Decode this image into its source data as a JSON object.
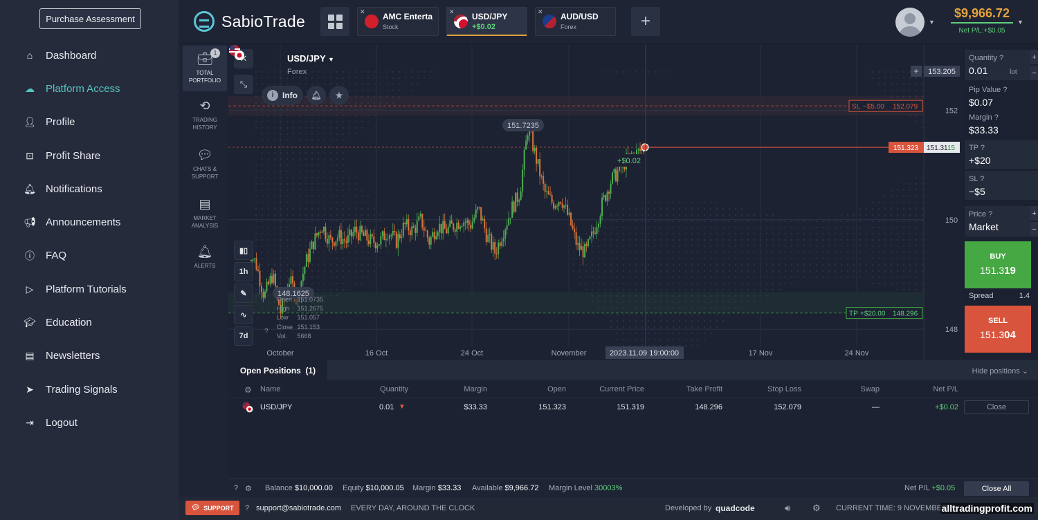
{
  "site_sidebar": {
    "purchase_label": "Purchase Assessment",
    "items": [
      {
        "label": "Dashboard",
        "icon": "home-icon"
      },
      {
        "label": "Platform Access",
        "icon": "cloud-download-icon",
        "active": true
      },
      {
        "label": "Profile",
        "icon": "user-icon"
      },
      {
        "label": "Profit Share",
        "icon": "profit-share-icon"
      },
      {
        "label": "Notifications",
        "icon": "bell-icon"
      },
      {
        "label": "Announcements",
        "icon": "megaphone-icon"
      },
      {
        "label": "FAQ",
        "icon": "question-icon"
      },
      {
        "label": "Platform Tutorials",
        "icon": "play-icon"
      },
      {
        "label": "Education",
        "icon": "graduation-cap-icon"
      },
      {
        "label": "Newsletters",
        "icon": "newspaper-icon"
      },
      {
        "label": "Trading Signals",
        "icon": "telegram-icon"
      },
      {
        "label": "Logout",
        "icon": "logout-icon"
      }
    ]
  },
  "header": {
    "logo_text": "SabioTrade",
    "tabs": [
      {
        "name": "AMC Enterta...",
        "sub": "Stock"
      },
      {
        "name": "USD/JPY",
        "sub": "+$0.02"
      },
      {
        "name": "AUD/USD",
        "sub": "Forex"
      }
    ],
    "balance": "$9,966.72",
    "net_pl": "Net P/L:+$0.05"
  },
  "tools": [
    {
      "label1": "TOTAL",
      "label2": "PORTFOLIO",
      "badge": "1"
    },
    {
      "label1": "TRADING",
      "label2": "HISTORY"
    },
    {
      "label1": "CHATS &",
      "label2": "SUPPORT"
    },
    {
      "label1": "MARKET",
      "label2": "ANALYSIS"
    },
    {
      "label1": "ALERTS",
      "label2": ""
    }
  ],
  "chart": {
    "asset": "USD/JPY",
    "asset_type": "Forex",
    "info_label": "Info",
    "timeframes": [
      "1h",
      "7d"
    ],
    "ohlc": {
      "open": "151.0735",
      "high": "151.2675",
      "low": "151.057",
      "close": "151.153",
      "vol": "5668"
    },
    "ohlc_labels": {
      "open": "Open",
      "high": "High",
      "low": "Low",
      "close": "Close",
      "vol": "Vol."
    },
    "sl_label": "SL",
    "sl_amount": "−$5.00",
    "sl_price": "152.079",
    "tp_label": "TP",
    "tp_amount": "+$20.00",
    "tp_price": "148.296",
    "open_price": "151.323",
    "current_price_main": "151.31",
    "current_price_tail": "15",
    "top_price": "153.205",
    "high_label": "151.7235",
    "low_label": "148.1625",
    "pl_label": "+$0.02",
    "crosshair_time": "2023.11.09 19:00:00"
  },
  "chart_data": {
    "type": "candlestick",
    "y_ticks": [
      "152",
      "150",
      "148"
    ],
    "x_ticks": [
      "October",
      "16 Oct",
      "24 Oct",
      "November",
      "17 Nov",
      "24 Nov"
    ],
    "ylim": [
      147.9,
      152.7
    ],
    "series": [
      {
        "name": "USD/JPY",
        "values": [
          149.5,
          149.2,
          148.6,
          149.0,
          148.3,
          148.9,
          148.6,
          149.2,
          149.6,
          149.9,
          149.6,
          149.7,
          149.6,
          149.8,
          149.7,
          149.6,
          149.6,
          149.8,
          149.6,
          149.9,
          149.8,
          150.0,
          149.6,
          149.9,
          149.8,
          149.9,
          150.0,
          149.9,
          150.2,
          149.7,
          149.4,
          149.8,
          150.2,
          150.5,
          151.7,
          151.1,
          150.5,
          150.3,
          150.4,
          150.0,
          149.5,
          149.4,
          149.8,
          150.3,
          150.7,
          150.9,
          151.1,
          151.2,
          151.3
        ]
      }
    ]
  },
  "trade": {
    "quantity_label": "Quantity",
    "quantity": "0.01",
    "quantity_unit": "lot",
    "pip_label": "Pip Value",
    "pip": "$0.07",
    "margin_label": "Margin",
    "margin": "$33.33",
    "tp_label": "TP",
    "tp": "+$20",
    "sl_label": "SL",
    "sl": "−$5",
    "price_label": "Price",
    "price": "Market",
    "buy_label": "BUY",
    "buy_price_main": "151.3",
    "buy_price_tail": "19",
    "spread_label": "Spread",
    "spread": "1.4",
    "sell_label": "SELL",
    "sell_price_main": "151.3",
    "sell_price_tail": "04"
  },
  "positions": {
    "tab_label": "Open Positions",
    "tab_count": "(1)",
    "hide_label": "Hide positions",
    "columns": [
      "Name",
      "Quantity",
      "Margin",
      "Open",
      "Current Price",
      "Take Profit",
      "Stop Loss",
      "Swap",
      "Net P/L"
    ],
    "rows": [
      {
        "name": "USD/JPY",
        "quantity": "0.01",
        "margin": "$33.33",
        "open": "151.323",
        "current": "151.319",
        "tp": "148.296",
        "sl": "152.079",
        "swap": "—",
        "net": "+$0.02",
        "close_label": "Close"
      }
    ]
  },
  "status": {
    "balance_label": "Balance",
    "balance": "$10,000.00",
    "equity_label": "Equity",
    "equity": "$10,000.05",
    "margin_label": "Margin",
    "margin": "$33.33",
    "available_label": "Available",
    "available": "$9,966.72",
    "level_label": "Margin Level",
    "level": "30003%",
    "netpl_label": "Net P/L",
    "netpl": "+$0.05",
    "close_all_label": "Close All"
  },
  "footer": {
    "support_label": "SUPPORT",
    "email": "support@sabiotrade.com",
    "hours": "EVERY DAY, AROUND THE CLOCK",
    "developed_by": "Developed by",
    "developer": "quadcode",
    "current_time": "CURRENT TIME: 9 NOVEMBER",
    "watermark": "alltradingprofit.com"
  },
  "colors": {
    "accent_teal": "#54c7c0",
    "balance_orange": "#e6a23a",
    "profit_green": "#5fd07b",
    "sell_red": "#d9543c",
    "buy_green": "#45a843"
  }
}
